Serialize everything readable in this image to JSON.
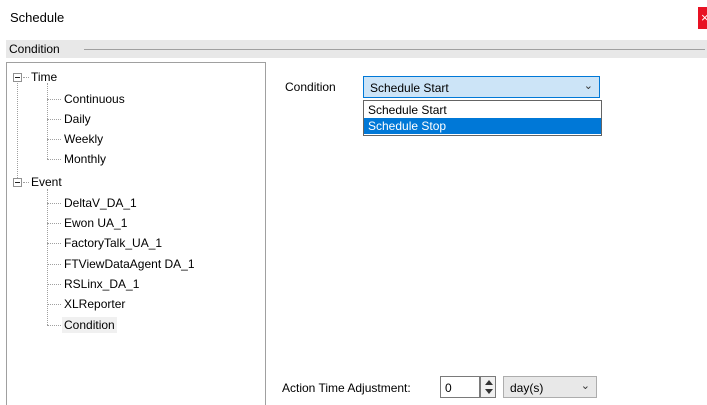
{
  "window": {
    "title": "Schedule",
    "close_glyph": "×"
  },
  "group": {
    "label": "Condition"
  },
  "tree": {
    "time": {
      "label": "Time",
      "children": [
        "Continuous",
        "Daily",
        "Weekly",
        "Monthly"
      ]
    },
    "event": {
      "label": "Event",
      "children": [
        "DeltaV_DA_1",
        "Ewon UA_1",
        "FactoryTalk_UA_1",
        "FTViewDataAgent DA_1",
        "RSLinx_DA_1",
        "XLReporter",
        "Condition"
      ]
    },
    "selected": "Condition"
  },
  "condition": {
    "label": "Condition",
    "value": "Schedule Start",
    "options": [
      "Schedule Start",
      "Schedule Stop"
    ],
    "highlighted": "Schedule Stop",
    "arrow_icon": "chevron-down-icon"
  },
  "action_time": {
    "label": "Action Time Adjustment:",
    "value": "0",
    "unit": "day(s)"
  },
  "colors": {
    "accent": "#0078d7",
    "close": "#e81123"
  }
}
